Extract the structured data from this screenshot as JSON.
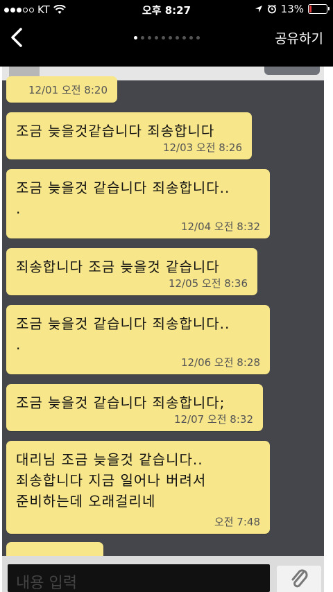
{
  "status_bar": {
    "carrier": "KT",
    "time": "오후 8:27",
    "battery": "13%",
    "battery_level": 0.13,
    "signal_bars_filled": 3,
    "signal_bars_total": 5
  },
  "nav": {
    "share_label": "공유하기",
    "page_count": 10,
    "active_page": 1
  },
  "messages": [
    {
      "text": "조금 늦을것같습니다 죄송합니다",
      "time": "12/03 오전 8:26"
    },
    {
      "text": "조금 늦을것 같습니다 죄송합니다..\n.",
      "time": "12/04 오전 8:32"
    },
    {
      "text": "죄송합니다 조금 늦을것 같습니다",
      "time": "12/05 오전 8:36"
    },
    {
      "text": "조금 늦을것 같습니다 죄송합니다..\n.",
      "time": "12/06 오전 8:28"
    },
    {
      "text": "조금 늦을것 같습니다 죄송합니다;",
      "time": "12/07 오전 8:32"
    },
    {
      "text": "대리님 조금 늦을것 같습니다..\n죄송합니다 지금 일어나 버려서\n준비하는데 오래걸리네",
      "time": "오전 7:48"
    }
  ],
  "partial_top_time": "12/01 오전 8:20",
  "input_placeholder": "내용 입력",
  "colors": {
    "bubble": "#f7e68a",
    "chat_background": "#44464c",
    "battery_low": "#e43c3c"
  }
}
